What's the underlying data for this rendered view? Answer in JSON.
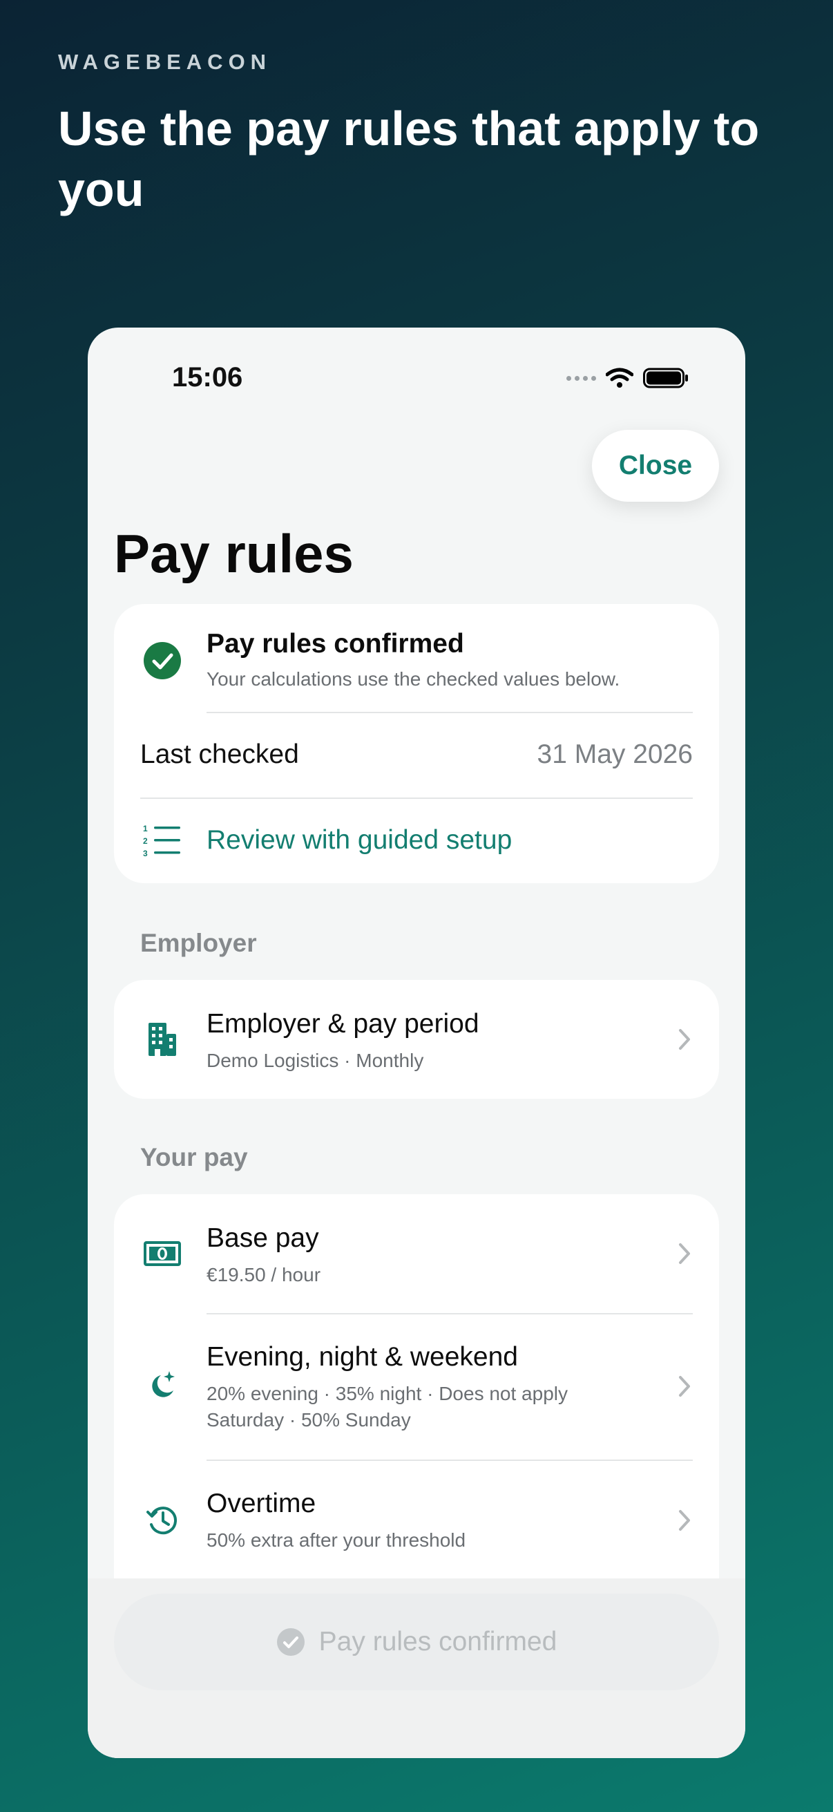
{
  "brand": "WAGEBEACON",
  "headline": "Use the pay rules that apply to you",
  "status_bar": {
    "time": "15:06"
  },
  "header": {
    "close_label": "Close",
    "title": "Pay rules"
  },
  "status_card": {
    "title": "Pay rules confirmed",
    "subtitle": "Your calculations use the checked values below.",
    "last_checked_label": "Last checked",
    "last_checked_value": "31 May 2026",
    "review_label": "Review with guided setup"
  },
  "employer_section": {
    "label": "Employer",
    "item": {
      "title": "Employer & pay period",
      "subtitle": "Demo Logistics · Monthly"
    }
  },
  "pay_section": {
    "label": "Your pay",
    "items": [
      {
        "title": "Base pay",
        "subtitle": "€19.50 / hour"
      },
      {
        "title": "Evening, night & weekend",
        "subtitle": "20% evening · 35% night · Does not apply Saturday · 50% Sunday"
      },
      {
        "title": "Overtime",
        "subtitle": "50% extra after your threshold"
      }
    ]
  },
  "footer": {
    "confirm_label": "Pay rules confirmed"
  },
  "colors": {
    "accent": "#137e70",
    "check_green": "#1a7a44",
    "disabled": "#b8bcbe"
  }
}
